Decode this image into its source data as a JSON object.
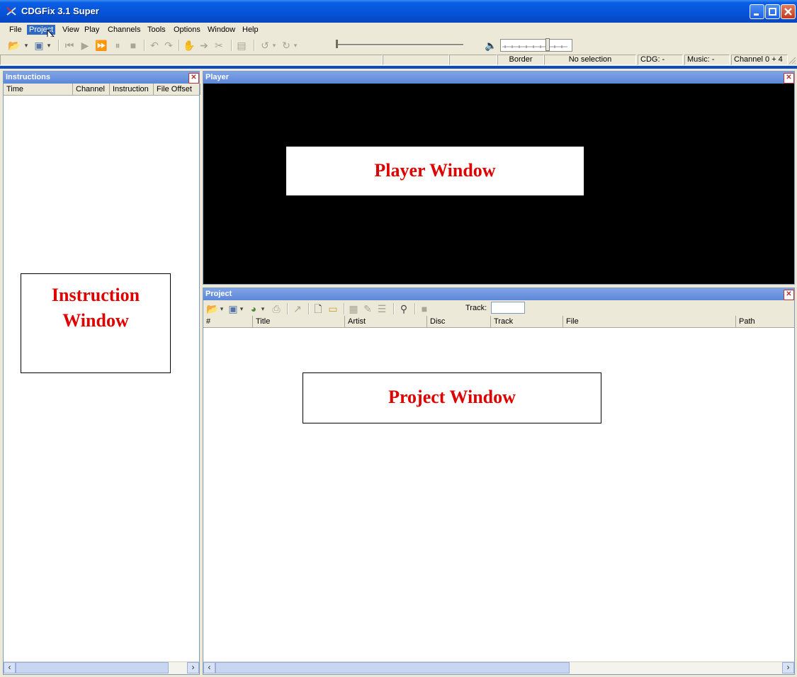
{
  "window": {
    "title": "CDGFix 3.1 Super"
  },
  "menu": [
    "File",
    "Project",
    "View",
    "Play",
    "Channels",
    "Tools",
    "Options",
    "Window",
    "Help"
  ],
  "menu_active_index": 1,
  "status": {
    "border": "Border",
    "selection": "No selection",
    "cdg": "CDG: -",
    "music": "Music: -",
    "channel": "Channel 0 + 4"
  },
  "instructions": {
    "title": "Instructions",
    "columns": [
      "Time",
      "Channel",
      "Instruction",
      "File Offset"
    ],
    "annotation": [
      "Instruction",
      "Window"
    ]
  },
  "player": {
    "title": "Player",
    "annotation": "Player Window",
    "screen_color": "#000000"
  },
  "project": {
    "title": "Project",
    "track_label": "Track:",
    "track_value": "",
    "columns": [
      "#",
      "Title",
      "Artist",
      "Disc",
      "Track",
      "File",
      "Path"
    ],
    "annotation": "Project Window"
  },
  "colors": {
    "titlebar": "#0553d8",
    "panel_caption": "#7fa3e6",
    "annotation_text": "#e00000"
  }
}
